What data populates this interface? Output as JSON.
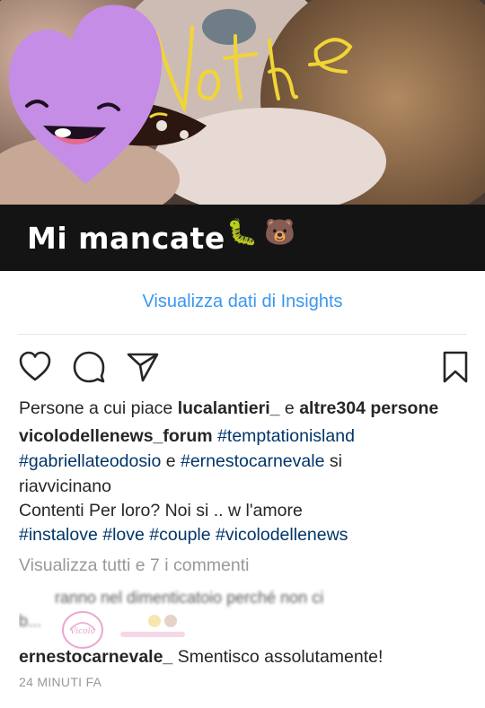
{
  "post_image": {
    "handwriting": "Nothe",
    "caption": "Mi mancate",
    "emoji_1": "🐛",
    "emoji_2": "🐻"
  },
  "insights": {
    "label": "Visualizza dati di Insights",
    "color": "#3897f0"
  },
  "actions": {
    "like_icon": "heart-outline-icon",
    "comment_icon": "speech-bubble-icon",
    "share_icon": "paper-plane-icon",
    "save_icon": "bookmark-icon"
  },
  "likes": {
    "prefix": "Persone a cui piace ",
    "user": "lucalantieri_",
    "connector": " e ",
    "others": "altre304 persone"
  },
  "caption": {
    "author": "vicolodellenews_forum",
    "line1_tag": "#temptationisland",
    "line2_tag1": "#gabriellateodosio",
    "line2_text": " e ",
    "line2_tag2": "#ernestocarnevale",
    "line2_end": " si",
    "line3": "riavvicinano",
    "line4": "Contenti Per loro? Noi si .. w l'amore",
    "hashtags": [
      "#instalove",
      "#love",
      "#couple",
      "#vicolodellenews"
    ]
  },
  "view_comments": "Visualizza tutti e 7 i commenti",
  "faded_comment": {
    "line1": "ranno nel dimenticatoio perché non ci",
    "line2": "b..."
  },
  "comment": {
    "user": "ernestocarnevale_",
    "text": "Smentisco assolutamente!"
  },
  "timestamp": "24 MINUTI FA",
  "colors": {
    "hashtag": "#003569",
    "muted": "#999999",
    "text": "#262626",
    "sticker": "#c58de6"
  }
}
